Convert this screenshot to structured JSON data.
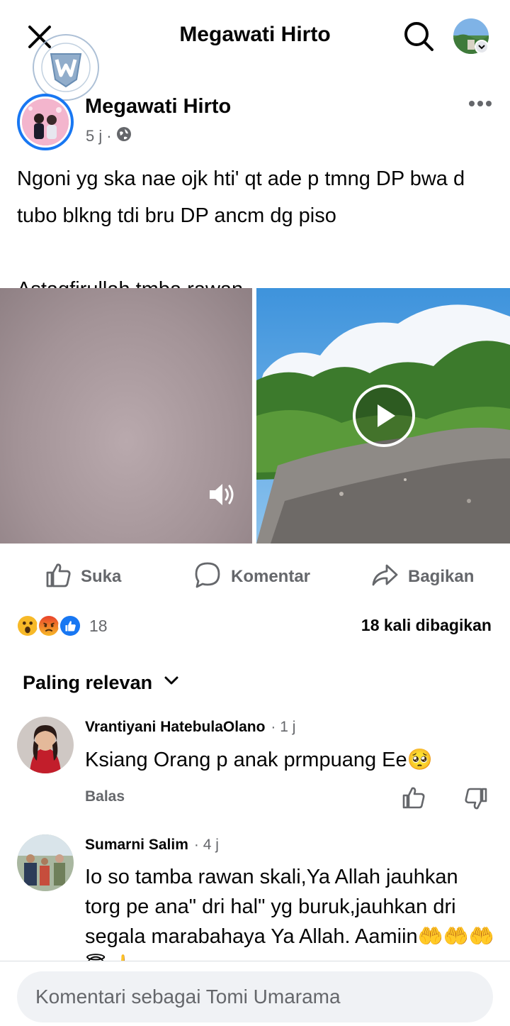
{
  "header": {
    "title": "Megawati Hirto",
    "icons": [
      "close-icon",
      "search-icon",
      "profile-avatar"
    ]
  },
  "post": {
    "author": "Megawati Hirto",
    "time": "5 j",
    "separator": "·",
    "visibility_icon": "globe-icon",
    "paragraphs": [
      "Ngoni yg ska nae ojk hti' qt ade p tmng DP bwa d tubo blkng tdi bru DP ancm dg piso",
      "Astagfirullah tmba rawan"
    ]
  },
  "actions": {
    "like_label": "Suka",
    "comment_label": "Komentar",
    "share_label": "Bagikan"
  },
  "stats": {
    "reaction_icons": [
      "wow-reaction-icon",
      "angry-reaction-icon",
      "like-reaction-icon"
    ],
    "reaction_count": "18",
    "share_count": "18 kali dibagikan"
  },
  "sort": {
    "label": "Paling relevan"
  },
  "comments": [
    {
      "name": "Vrantiyani HatebulaOlano",
      "time": "· 1 j",
      "text": "Ksiang Orang p anak prmpuang Ee🥺",
      "reply": "Balas"
    },
    {
      "name": "Sumarni Salim",
      "time": "· 4 j",
      "text": "Io so tamba rawan skali,Ya Allah jauhkan torg pe ana\" dri hal\" yg buruk,jauhkan dri segala marabahaya Ya Allah. Aamiin🤲🤲🤲😇☝️"
    }
  ],
  "composer": {
    "placeholder": "Komentari sebagai Tomi Umarama"
  },
  "colors": {
    "accent": "#1877f2",
    "secondary_text": "#65676b",
    "input_bg": "#f0f2f5"
  }
}
